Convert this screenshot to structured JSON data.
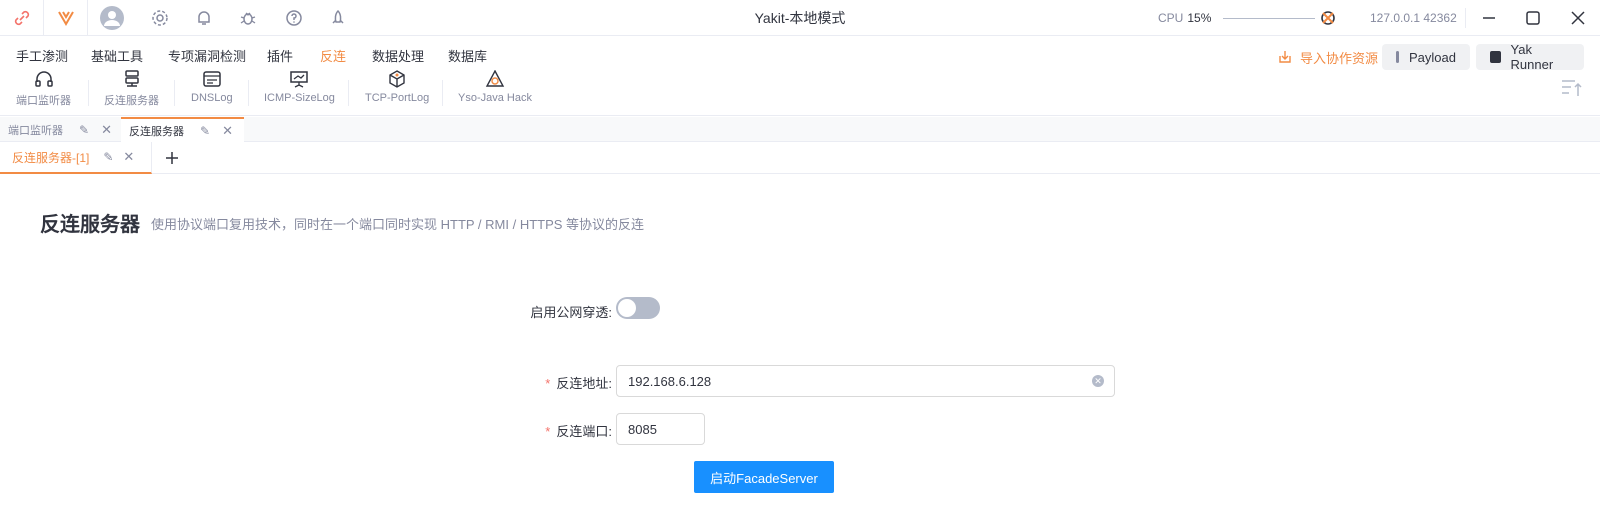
{
  "app": {
    "title": "Yakit-本地模式",
    "cpu_label": "CPU",
    "cpu_value": "15%",
    "address": "127.0.0.1 42362"
  },
  "menu": {
    "items": [
      "手工渗测",
      "基础工具",
      "专项漏洞检测",
      "插件",
      "反连",
      "数据处理",
      "数据库"
    ],
    "active_index": 4,
    "sub_items": [
      "端口监听器",
      "反连服务器",
      "DNSLog",
      "ICMP-SizeLog",
      "TCP-PortLog",
      "Yso-Java Hack"
    ],
    "import_label": "导入协作资源",
    "payload_label": "Payload",
    "yak_runner_label": "Yak Runner"
  },
  "tabs": {
    "level1": [
      "端口监听器",
      "反连服务器"
    ],
    "level2": [
      "反连服务器-[1]"
    ]
  },
  "page": {
    "title": "反连服务器",
    "description": "使用协议端口复用技术，同时在一个端口同时实现 HTTP / RMI / HTTPS 等协议的反连"
  },
  "form": {
    "toggle_label": "启用公网穿透",
    "toggle_on": false,
    "address_label": "反连地址",
    "address_value": "192.168.6.128",
    "port_label": "反连端口",
    "port_value": "8085",
    "submit_label": "启动FacadeServer"
  },
  "colors": {
    "accent": "#f28b44",
    "primary": "#1890ff",
    "required": "#f4736b"
  }
}
